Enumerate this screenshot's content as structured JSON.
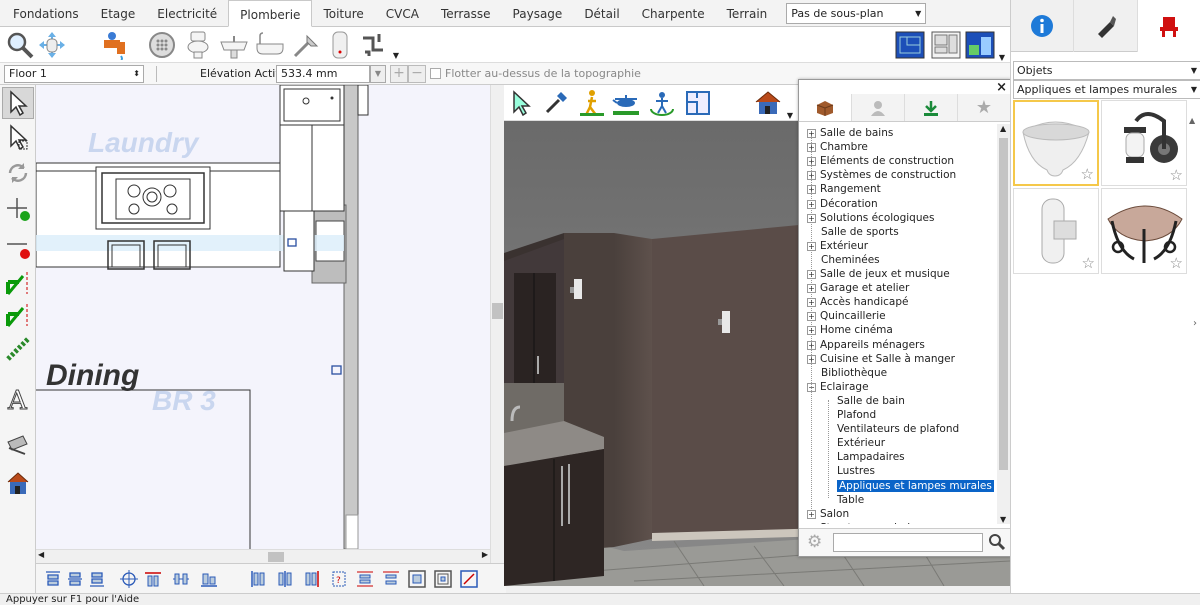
{
  "tabs": [
    "Fondations",
    "Etage",
    "Electricité",
    "Plomberie",
    "Toiture",
    "CVCA",
    "Terrasse",
    "Paysage",
    "Détail",
    "Charpente",
    "Terrain"
  ],
  "active_tab": "Plomberie",
  "plan_selector": "Pas de sous-plan",
  "floor": "Floor 1",
  "elevation": {
    "label": "Elévation Active:",
    "value": "533.4 mm"
  },
  "float_label": "Flotter au-dessus de la topographie",
  "rooms": {
    "laundry": "Laundry",
    "dining": "Dining",
    "br3": "BR 3"
  },
  "library": {
    "tree": [
      {
        "label": "Salle de bains",
        "level": 0,
        "exp": "+"
      },
      {
        "label": "Chambre",
        "level": 0,
        "exp": "+"
      },
      {
        "label": "Eléments de construction",
        "level": 0,
        "exp": "+"
      },
      {
        "label": "Systèmes de construction",
        "level": 0,
        "exp": "+"
      },
      {
        "label": "Rangement",
        "level": 0,
        "exp": "+"
      },
      {
        "label": "Décoration",
        "level": 0,
        "exp": "+"
      },
      {
        "label": "Solutions écologiques",
        "level": 0,
        "exp": "+"
      },
      {
        "label": "Salle de sports",
        "level": 0,
        "exp": ""
      },
      {
        "label": "Extérieur",
        "level": 0,
        "exp": "+"
      },
      {
        "label": "Cheminées",
        "level": 0,
        "exp": ""
      },
      {
        "label": "Salle de jeux et musique",
        "level": 0,
        "exp": "+"
      },
      {
        "label": "Garage et atelier",
        "level": 0,
        "exp": "+"
      },
      {
        "label": "Accès handicapé",
        "level": 0,
        "exp": "+"
      },
      {
        "label": "Quincaillerie",
        "level": 0,
        "exp": "+"
      },
      {
        "label": "Home cinéma",
        "level": 0,
        "exp": "+"
      },
      {
        "label": "Appareils ménagers",
        "level": 0,
        "exp": "+"
      },
      {
        "label": "Cuisine et Salle à manger",
        "level": 0,
        "exp": "+"
      },
      {
        "label": "Bibliothèque",
        "level": 0,
        "exp": ""
      },
      {
        "label": "Eclairage",
        "level": 0,
        "exp": "−"
      },
      {
        "label": "Salle de bain",
        "level": 1,
        "exp": ""
      },
      {
        "label": "Plafond",
        "level": 1,
        "exp": ""
      },
      {
        "label": "Ventilateurs de plafond",
        "level": 1,
        "exp": ""
      },
      {
        "label": "Extérieur",
        "level": 1,
        "exp": ""
      },
      {
        "label": "Lampadaires",
        "level": 1,
        "exp": ""
      },
      {
        "label": "Lustres",
        "level": 1,
        "exp": ""
      },
      {
        "label": "Appliques et lampes murales",
        "level": 1,
        "exp": "",
        "selected": true
      },
      {
        "label": "Table",
        "level": 1,
        "exp": ""
      },
      {
        "label": "Salon",
        "level": 0,
        "exp": "+"
      },
      {
        "label": "Structures en bois",
        "level": 0,
        "exp": "+"
      }
    ]
  },
  "right_panel": {
    "type_select": "Objets",
    "category_select": "Appliques et lampes murales"
  },
  "status": "Appuyer sur F1 pour l'Aide",
  "colors": {
    "selection": "#0a64c8",
    "accent_thumb": "#f5c84a"
  }
}
